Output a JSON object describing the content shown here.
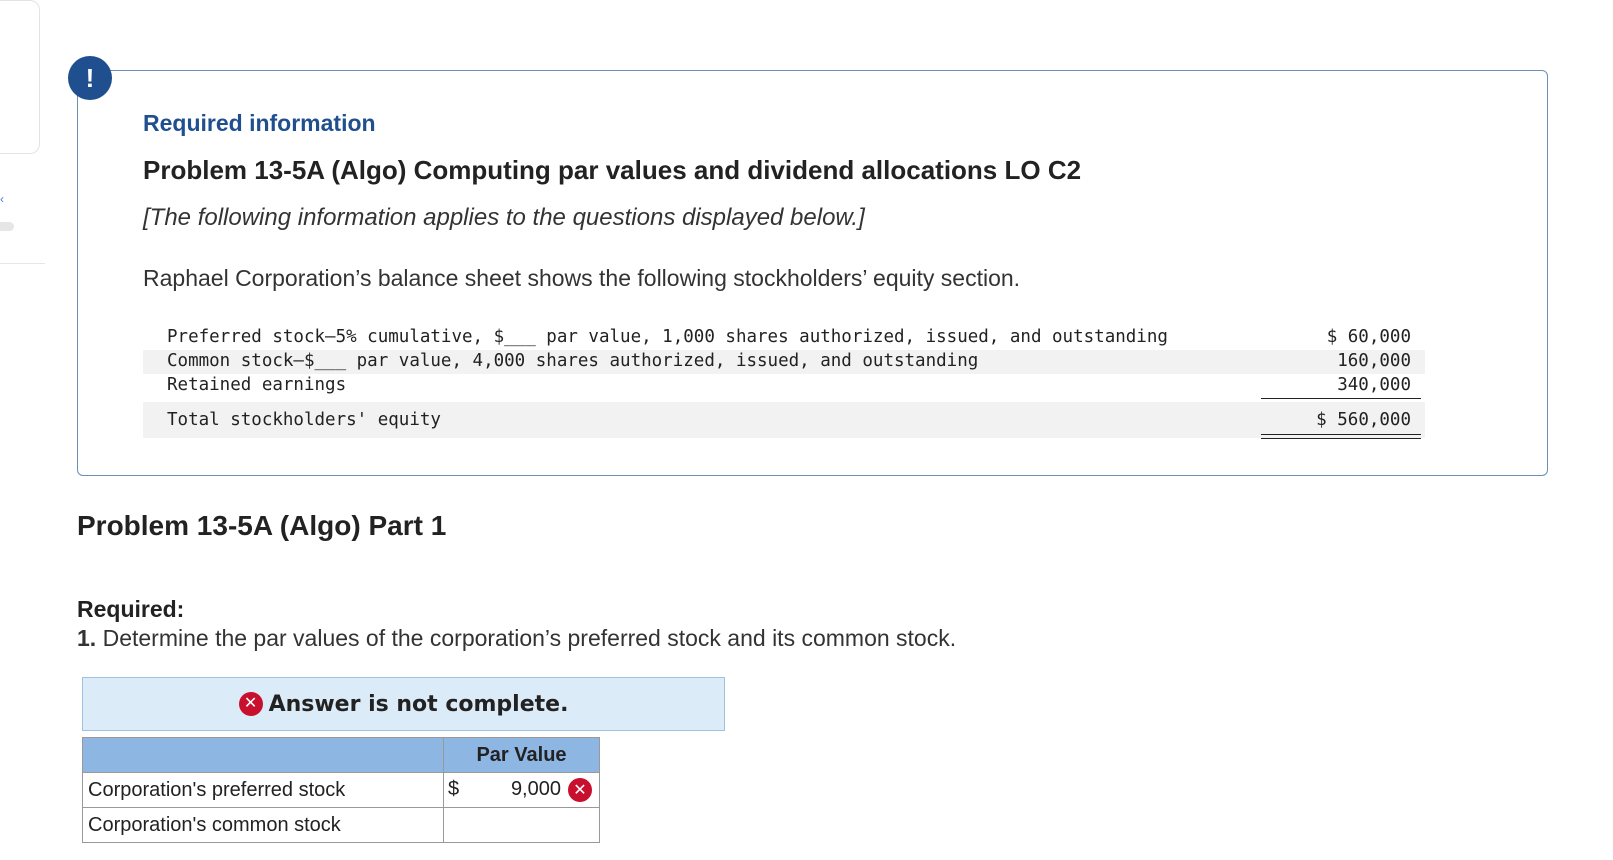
{
  "required_info": {
    "heading": "Required information",
    "problem_title": "Problem 13-5A (Algo) Computing par values and dividend allocations LO C2",
    "applies_note": "[The following information applies to the questions displayed below.]",
    "intro": "Raphael Corporation’s balance sheet shows the following stockholders’ equity section."
  },
  "equity_section": {
    "rows": [
      {
        "label": "Preferred stock—5% cumulative, $___ par value, 1,000 shares authorized, issued, and outstanding",
        "amount": "$ 60,000"
      },
      {
        "label": "Common stock—$___ par value, 4,000 shares authorized, issued, and outstanding",
        "amount": "160,000"
      },
      {
        "label": "Retained earnings",
        "amount": "340,000"
      }
    ],
    "total": {
      "label": "Total stockholders' equity",
      "amount": "$ 560,000"
    }
  },
  "part": {
    "title": "Problem 13-5A (Algo) Part 1",
    "required_label": "Required:",
    "required_number": "1.",
    "required_text": "Determine the par values of the corporation’s preferred stock and its common stock."
  },
  "answer": {
    "status": "Answer is not complete.",
    "header_value": "Par Value",
    "rows": [
      {
        "label": "Corporation's preferred stock",
        "dollar": "$",
        "value": "9,000",
        "incorrect": true
      },
      {
        "label": "Corporation's common stock",
        "dollar": "",
        "value": "",
        "incorrect": false
      }
    ]
  },
  "colors": {
    "accent": "#1f4f8f",
    "error": "#c8102e",
    "banner_bg": "#dcebf8",
    "header_bg": "#8eb6e3"
  }
}
